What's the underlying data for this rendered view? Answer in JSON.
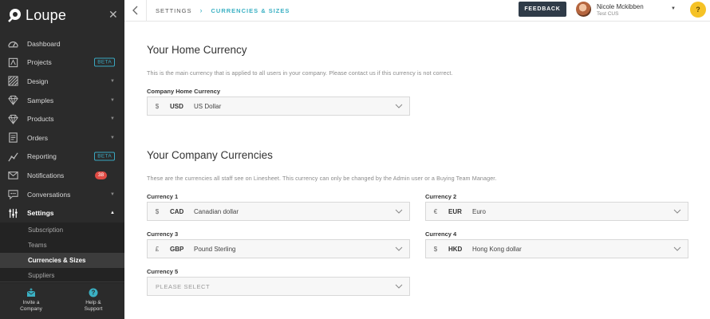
{
  "app": {
    "name": "Loupe"
  },
  "sidebar": {
    "items": [
      {
        "label": "Dashboard",
        "icon": "dashboard-icon",
        "badge": "",
        "caret": false
      },
      {
        "label": "Projects",
        "icon": "projects-icon",
        "badge": "BETA",
        "caret": false
      },
      {
        "label": "Design",
        "icon": "design-icon",
        "badge": "",
        "caret": true
      },
      {
        "label": "Samples",
        "icon": "diamond-icon",
        "badge": "",
        "caret": true
      },
      {
        "label": "Products",
        "icon": "diamond-icon",
        "badge": "",
        "caret": true
      },
      {
        "label": "Orders",
        "icon": "orders-icon",
        "badge": "",
        "caret": true
      },
      {
        "label": "Reporting",
        "icon": "reporting-icon",
        "badge": "BETA",
        "caret": false
      },
      {
        "label": "Notifications",
        "icon": "mail-icon",
        "count": "38",
        "caret": false
      },
      {
        "label": "Conversations",
        "icon": "chat-icon",
        "badge": "",
        "caret": true
      },
      {
        "label": "Settings",
        "icon": "sliders-icon",
        "badge": "",
        "caret": true
      }
    ],
    "sub_items": [
      "Subscription",
      "Teams",
      "Currencies & Sizes",
      "Suppliers"
    ],
    "bottom": {
      "invite_line1": "Invite a",
      "invite_line2": "Company",
      "help_line1": "Help &",
      "help_line2": "Support"
    }
  },
  "topbar": {
    "breadcrumb_root": "SETTINGS",
    "breadcrumb_sep": "›",
    "breadcrumb_current": "CURRENCIES & SIZES",
    "feedback_label": "FEEDBACK",
    "user_name": "Nicole Mckibben",
    "user_org": "Test CUS",
    "help_label": "?"
  },
  "home": {
    "title": "Your Home Currency",
    "description": "This is the main currency that is applied to all users in your company. Please contact us if this currency is not correct.",
    "field_label": "Company Home Currency",
    "symbol": "$",
    "code": "USD",
    "name": "US Dollar"
  },
  "company": {
    "title": "Your Company Currencies",
    "description": "These are the currencies all staff see on Linesheet. This currency can only be changed by the Admin user or a Buying Team Manager.",
    "currencies": [
      {
        "label": "Currency 1",
        "symbol": "$",
        "code": "CAD",
        "name": "Canadian dollar"
      },
      {
        "label": "Currency 2",
        "symbol": "€",
        "code": "EUR",
        "name": "Euro"
      },
      {
        "label": "Currency 3",
        "symbol": "£",
        "code": "GBP",
        "name": "Pound Sterling"
      },
      {
        "label": "Currency 4",
        "symbol": "$",
        "code": "HKD",
        "name": "Hong Kong dollar"
      },
      {
        "label": "Currency 5",
        "placeholder": "PLEASE SELECT"
      }
    ]
  },
  "colors": {
    "accent": "#3ab0c3",
    "sidebar": "#2b2b2b",
    "badge_red": "#e04b44",
    "help": "#f5c226"
  }
}
